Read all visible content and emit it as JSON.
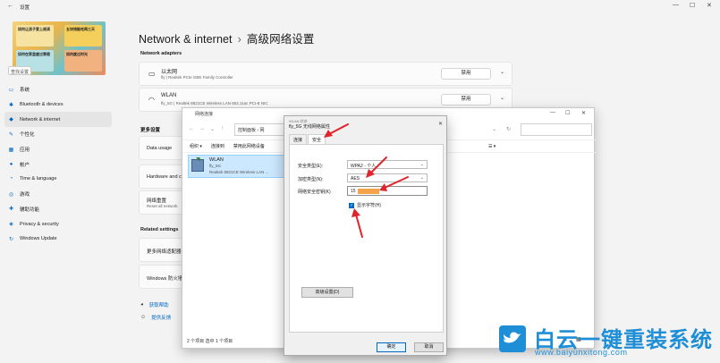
{
  "settings": {
    "app_title": "设置",
    "search_placeholder": "查找设置",
    "avatar_tiles": [
      {
        "text": "如何让孩子爱上阅读",
        "color": "#f7e3a1"
      },
      {
        "text": "五块钱能吃两三天",
        "color": "#f5cf5b"
      },
      {
        "text": "如何在家里度过寒假",
        "color": "#b7e1e5"
      },
      {
        "text": "如何度过时光",
        "color": "#f2b27f"
      }
    ],
    "nav": [
      {
        "label": "系统",
        "icon": "system-icon",
        "glyph": "▭"
      },
      {
        "label": "Bluetooth & devices",
        "icon": "bluetooth-icon",
        "glyph": "✱"
      },
      {
        "label": "Network & internet",
        "icon": "network-icon",
        "glyph": "◆",
        "active": true
      },
      {
        "label": "个性化",
        "icon": "personalization-icon",
        "glyph": "✎"
      },
      {
        "label": "应用",
        "icon": "apps-icon",
        "glyph": "▦"
      },
      {
        "label": "帐户",
        "icon": "accounts-icon",
        "glyph": "●"
      },
      {
        "label": "Time & language",
        "icon": "time-language-icon",
        "glyph": "◔"
      },
      {
        "label": "游戏",
        "icon": "gaming-icon",
        "glyph": "◎"
      },
      {
        "label": "辅助功能",
        "icon": "accessibility-icon",
        "glyph": "✚"
      },
      {
        "label": "Privacy & security",
        "icon": "shield-icon",
        "glyph": "◈"
      },
      {
        "label": "Windows Update",
        "icon": "update-icon",
        "glyph": "↻"
      }
    ],
    "breadcrumb_parent": "Network & internet",
    "breadcrumb_sep": "›",
    "breadcrumb_current": "高级网络设置",
    "network_adapters_label": "Network adapters",
    "adapters": [
      {
        "name": "以太网",
        "sub": "fly | Realtek PCIe GBE Family Controller",
        "button": "禁用",
        "icon": "ethernet-icon"
      },
      {
        "name": "WLAN",
        "sub": "fly_5G | Realtek 8821CE Wireless LAN 802.11ac PCI-E NIC",
        "button": "禁用",
        "icon": "wifi-icon"
      }
    ],
    "more_settings_label": "更多设置",
    "more_items": [
      {
        "title": "Data usage",
        "sub": ""
      },
      {
        "title": "Hardware and c",
        "sub": ""
      },
      {
        "title": "网络重置",
        "sub": "Reset all network"
      }
    ],
    "related_label": "Related settings",
    "related_items": [
      {
        "title": "更多网络适配器"
      },
      {
        "title": "Windows 防火墙"
      }
    ],
    "help_link": "获取帮助",
    "feedback_link": "提供反馈"
  },
  "netconn": {
    "title": "网络连接",
    "address": "控制面板 › 网",
    "toolbar": [
      "组织 ▾",
      "连接到",
      "禁用此网络设备"
    ],
    "item": {
      "name": "WLAN",
      "ssid": "fly_5G",
      "adapter": "Realtek 8821CE Wireless LAN ..."
    },
    "status": "2 个项目    选中 1 个项目"
  },
  "wlan_props": {
    "caption": "WLAN 状态",
    "title": "fly_5G 无线网络属性",
    "tabs": [
      "连接",
      "安全"
    ],
    "security_type_label": "安全类型(E):",
    "security_type_value": "WPA2 - 个人",
    "encryption_label": "加密类型(N):",
    "encryption_value": "AES",
    "key_label": "网络安全密钥(K)",
    "key_value": "15",
    "show_chars_label": "显示字符(H)",
    "advanced_button": "高级设置(D)",
    "ok_button": "确定",
    "cancel_button": "取消"
  },
  "watermark": {
    "brand": "白云一键重装系统",
    "url": "www.baiyunxitong.com"
  },
  "colors": {
    "accent": "#0067c0",
    "arrow": "#e0242b",
    "watermark": "#1e8fd6",
    "key_mask": "#f5a34a"
  }
}
